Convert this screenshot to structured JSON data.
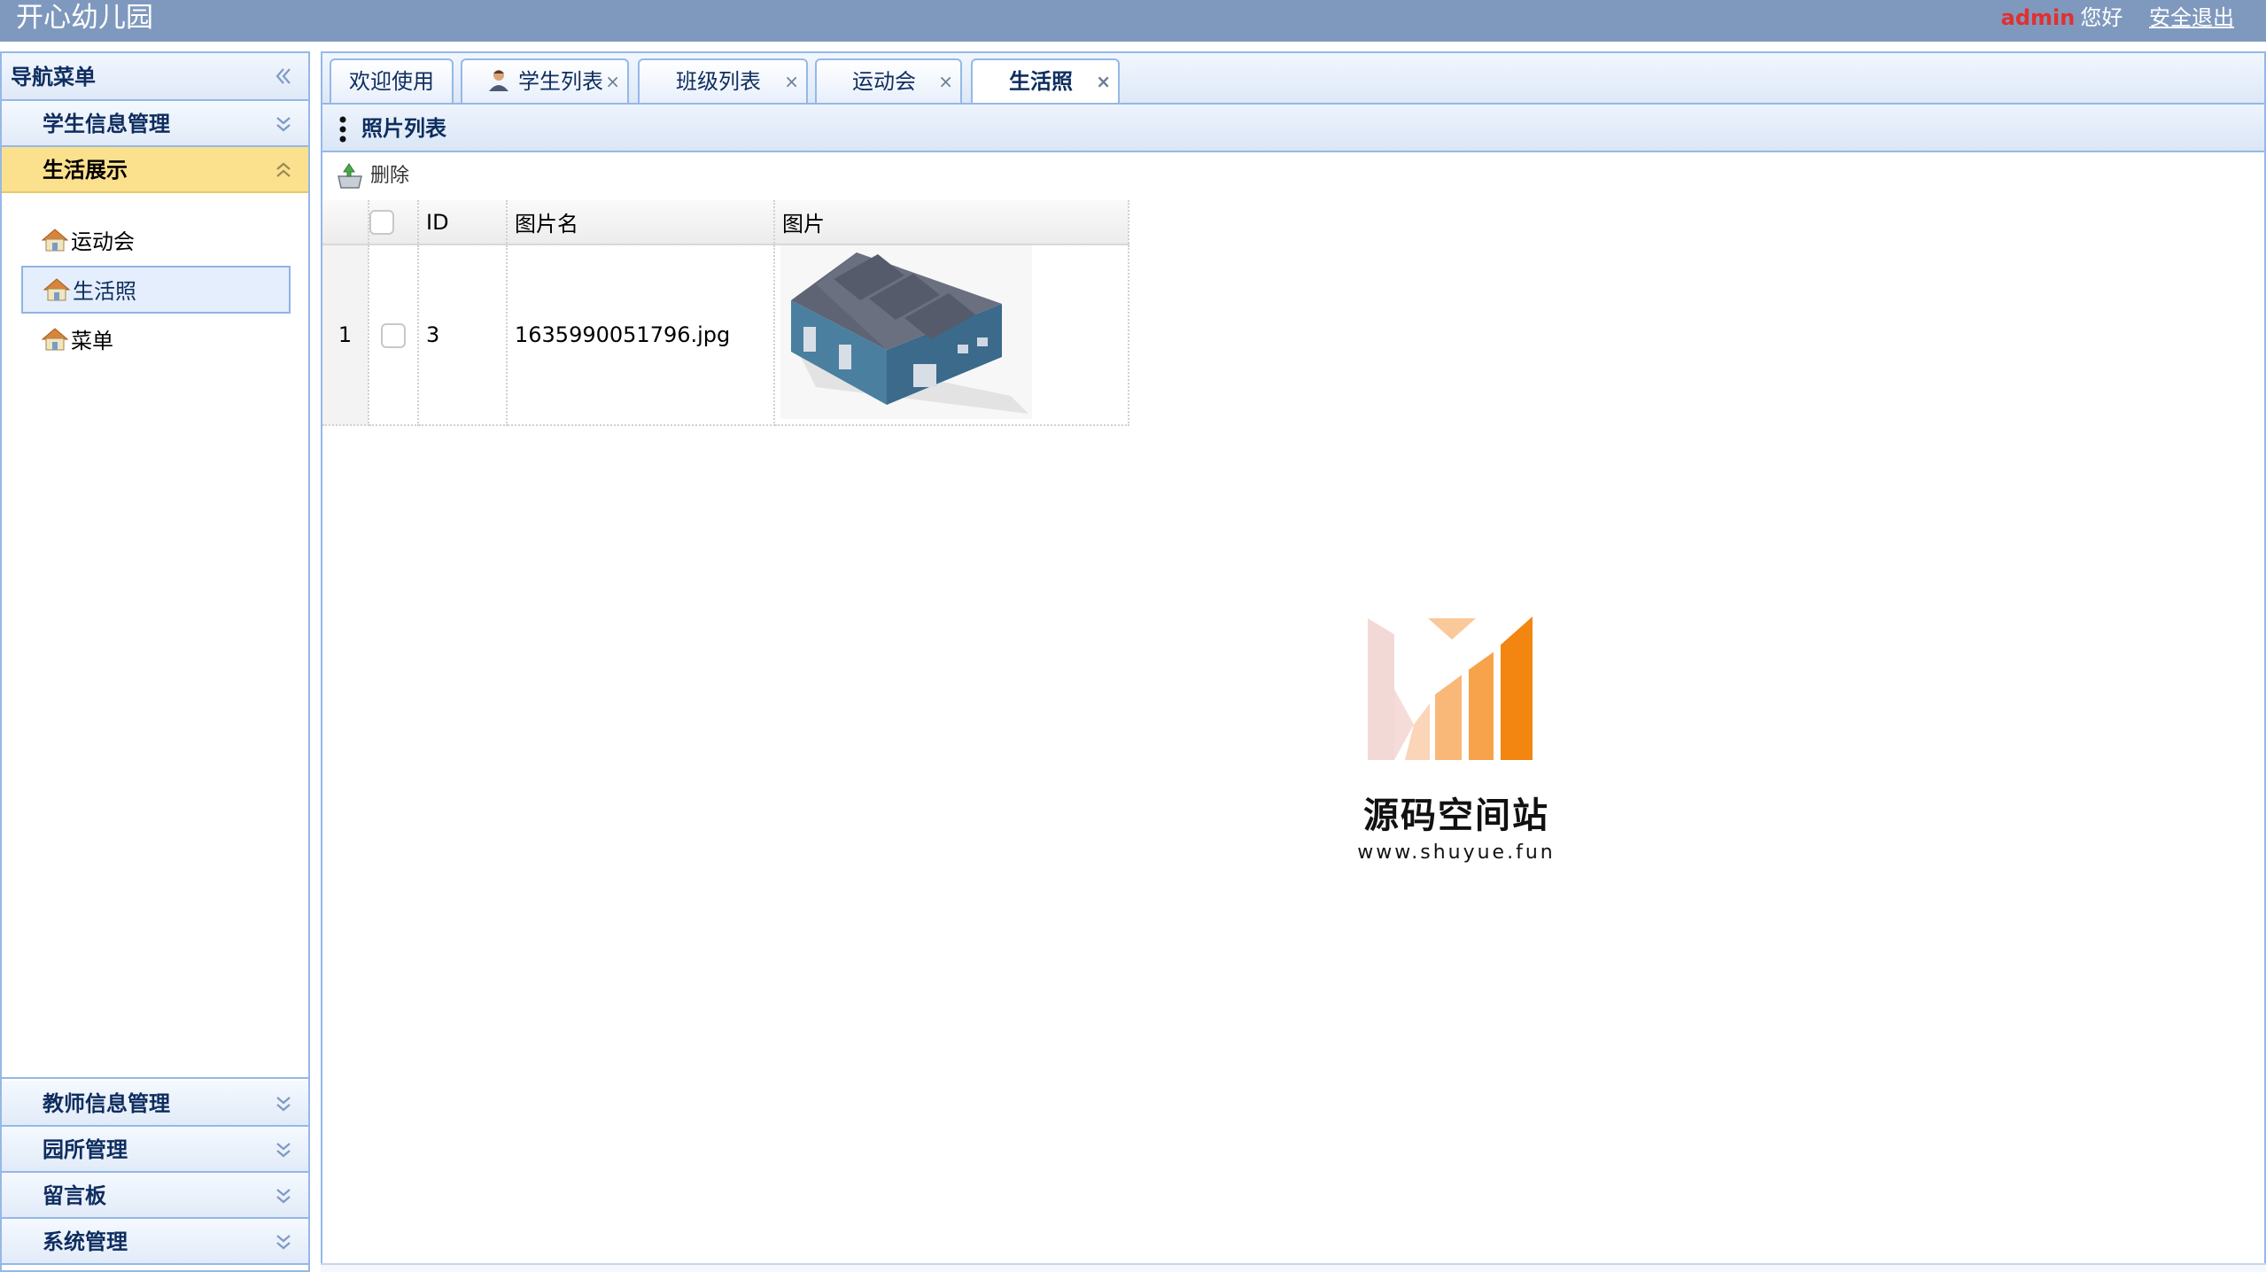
{
  "header": {
    "app_title": "开心幼儿园",
    "username": "admin",
    "greeting": "您好",
    "logout_label": "安全退出"
  },
  "nav": {
    "title": "导航菜单",
    "sections": [
      {
        "label": "学生信息管理",
        "expanded": false
      },
      {
        "label": "生活展示",
        "expanded": true,
        "items": [
          {
            "label": "运动会",
            "icon": "house-icon",
            "selected": false
          },
          {
            "label": "生活照",
            "icon": "house-icon",
            "selected": true
          },
          {
            "label": "菜单",
            "icon": "house-icon",
            "selected": false
          }
        ]
      },
      {
        "label": "教师信息管理",
        "expanded": false
      },
      {
        "label": "园所管理",
        "expanded": false
      },
      {
        "label": "留言板",
        "expanded": false
      },
      {
        "label": "系统管理",
        "expanded": false
      }
    ]
  },
  "tabs": [
    {
      "label": "欢迎使用",
      "closable": false,
      "active": false
    },
    {
      "label": "学生列表",
      "closable": true,
      "active": false,
      "icon": "user-avatar-icon"
    },
    {
      "label": "班级列表",
      "closable": true,
      "active": false
    },
    {
      "label": "运动会",
      "closable": true,
      "active": false
    },
    {
      "label": "生活照",
      "closable": true,
      "active": true
    }
  ],
  "tab_close_glyph": "×",
  "panel": {
    "title": "照片列表",
    "toolbar": {
      "delete_label": "删除"
    }
  },
  "grid": {
    "columns": [
      "ID",
      "图片名",
      "图片"
    ],
    "rows": [
      {
        "rownum": "1",
        "id": "3",
        "filename": "1635990051796.jpg",
        "image": "warehouse-building-image"
      }
    ]
  },
  "watermark": {
    "title": "源码空间站",
    "url": "www.shuyue.fun"
  },
  "colors": {
    "header_bg": "#7f99be",
    "border": "#95b8e7",
    "active_section": "#fbe08e",
    "username": "#e0312f"
  }
}
